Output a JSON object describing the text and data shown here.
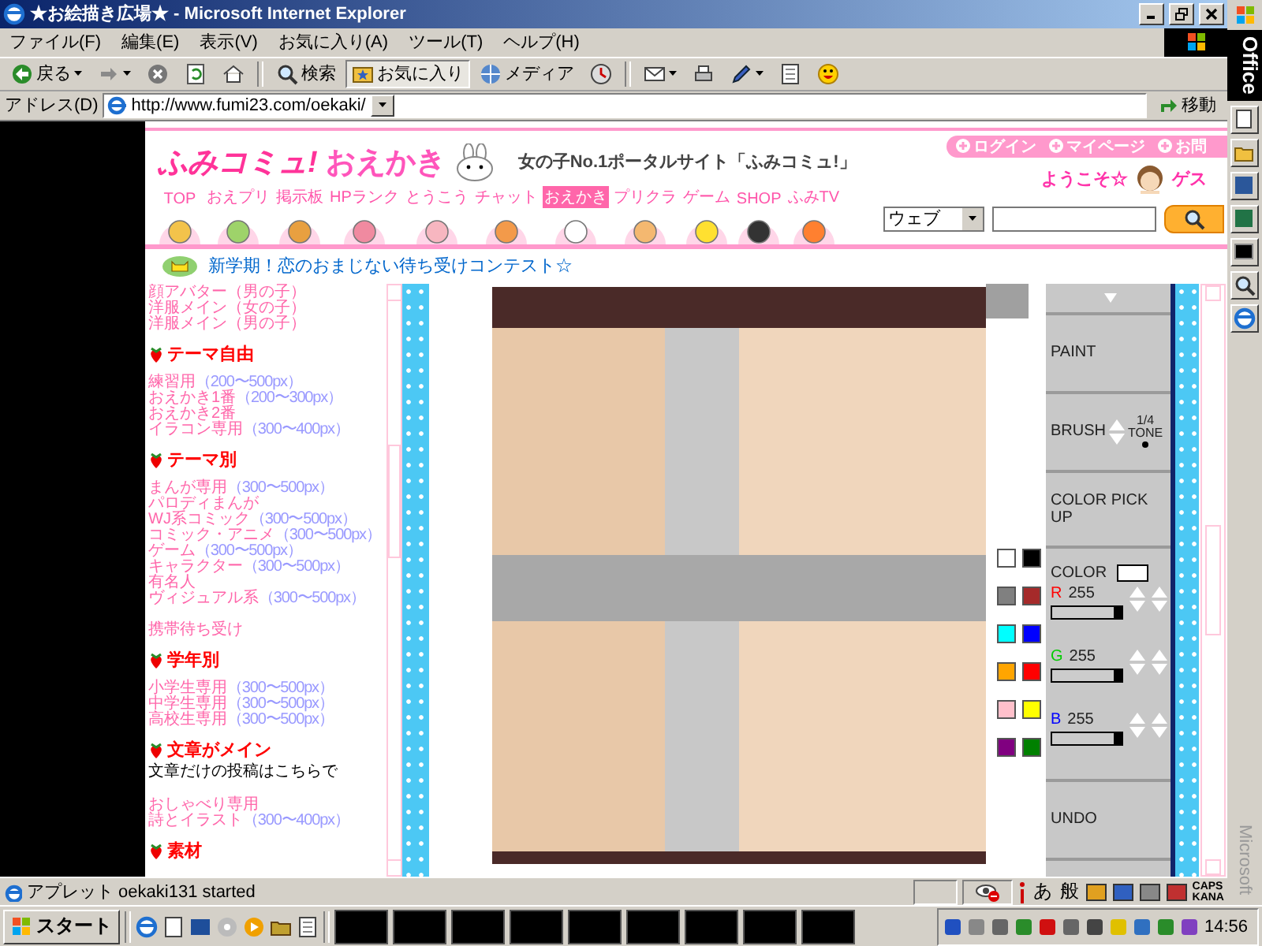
{
  "window": {
    "title": "★お絵描き広場★ - Microsoft Internet Explorer"
  },
  "menu": [
    "ファイル(F)",
    "編集(E)",
    "表示(V)",
    "お気に入り(A)",
    "ツール(T)",
    "ヘルプ(H)"
  ],
  "toolbar": [
    {
      "kind": "back",
      "label": "戻る",
      "pressed": false
    },
    {
      "kind": "forward",
      "pressed": false
    },
    {
      "kind": "stop",
      "pressed": false
    },
    {
      "kind": "refresh",
      "pressed": false
    },
    {
      "kind": "home",
      "pressed": false
    },
    {
      "kind": "search",
      "label": "検索",
      "pressed": false
    },
    {
      "kind": "favorites",
      "label": "お気に入り",
      "pressed": true
    },
    {
      "kind": "media",
      "label": "メディア",
      "pressed": false
    },
    {
      "kind": "history",
      "pressed": false
    },
    {
      "kind": "mail",
      "pressed": false
    },
    {
      "kind": "print",
      "pressed": false
    },
    {
      "kind": "edit",
      "pressed": false
    },
    {
      "kind": "discuss",
      "pressed": false
    },
    {
      "kind": "messenger",
      "pressed": false
    }
  ],
  "address_bar": {
    "label": "アドレス(D)",
    "url": "http://www.fumi23.com/oekaki/",
    "go": "移動"
  },
  "site_header": {
    "logo": "ふみコミュ!",
    "section": "おえかき",
    "tagline": "女の子No.1ポータルサイト「ふみコミュ!」",
    "account_links": [
      "ログイン",
      "マイページ",
      "お問"
    ],
    "welcome": "ようこそ☆",
    "user": "ゲス",
    "nav": [
      {
        "label": "TOP",
        "selected": false
      },
      {
        "label": "おえプリ",
        "selected": false
      },
      {
        "label": "掲示板",
        "selected": false
      },
      {
        "label": "HPランク",
        "selected": false
      },
      {
        "label": "とうこう",
        "selected": false
      },
      {
        "label": "チャット",
        "selected": false
      },
      {
        "label": "おえかき",
        "selected": true
      },
      {
        "label": "プリクラ",
        "selected": false
      },
      {
        "label": "ゲーム",
        "selected": false
      },
      {
        "label": "SHOP",
        "selected": false
      },
      {
        "label": "ふみTV",
        "selected": false
      }
    ],
    "search": {
      "scope": "ウェブ"
    }
  },
  "banner": "新学期！恋のおまじない待ち受けコンテスト☆",
  "sidebar": {
    "sections": [
      {
        "items": [
          {
            "name": "顔アバター（男の子）"
          },
          {
            "name": "洋服メイン（女の子）"
          },
          {
            "name": "洋服メイン（男の子）"
          }
        ]
      },
      {
        "heading": "テーマ自由",
        "items": [
          {
            "name": "練習用",
            "size": "（200〜500px）"
          },
          {
            "name": "おえかき1番",
            "size": "（200〜300px）"
          },
          {
            "name": "おえかき2番"
          },
          {
            "name": "イラコン専用",
            "size": "（300〜400px）"
          }
        ]
      },
      {
        "heading": "テーマ別",
        "items": [
          {
            "name": "まんが専用",
            "size": "（300〜500px）"
          },
          {
            "name": "パロディまんが"
          },
          {
            "name": "WJ系コミック",
            "size": "（300〜500px）"
          },
          {
            "name": "コミック・アニメ",
            "size": "（300〜500px）"
          },
          {
            "name": "ゲーム",
            "size": "（300〜500px）"
          },
          {
            "name": "キャラクター",
            "size": "（300〜500px）"
          },
          {
            "name": "有名人"
          },
          {
            "name": "ヴィジュアル系",
            "size": "（300〜500px）"
          }
        ]
      },
      {
        "items": [
          {
            "name": "携帯待ち受け"
          }
        ]
      },
      {
        "heading": "学年別",
        "items": [
          {
            "name": "小学生専用",
            "size": "（300〜500px）"
          },
          {
            "name": "中学生専用",
            "size": "（300〜500px）"
          },
          {
            "name": "高校生専用",
            "size": "（300〜500px）"
          }
        ]
      },
      {
        "heading": "文章がメイン",
        "note": "文章だけの投稿はこちらで"
      },
      {
        "items": [
          {
            "name": "おしゃべり専用"
          },
          {
            "name": "詩とイラスト",
            "size": "（300〜400px）"
          }
        ]
      },
      {
        "heading": "素材"
      }
    ]
  },
  "applet": {
    "palette": [
      {
        "color": "#ffffff"
      },
      {
        "color": "#000000"
      },
      {
        "color": "#808080"
      },
      {
        "color": "#a52a2a"
      },
      {
        "color": "#00ffff"
      },
      {
        "color": "#0000ff"
      },
      {
        "color": "#ffa500"
      },
      {
        "color": "#ff0000"
      },
      {
        "color": "#ffc0cb"
      },
      {
        "color": "#ffff00"
      },
      {
        "color": "#800080"
      },
      {
        "color": "#008000"
      }
    ],
    "tools": [
      {
        "kind": "button",
        "label": "PAINT"
      },
      {
        "kind": "brush",
        "label": "BRUSH",
        "size": "1/4",
        "mode": "TONE"
      },
      {
        "kind": "button",
        "label": "COLOR PICK UP"
      },
      {
        "kind": "color",
        "label": "COLOR",
        "channels": [
          {
            "name": "R",
            "color": "#ff0000",
            "value": "255",
            "level": 1
          },
          {
            "name": "G",
            "color": "#00cc00",
            "value": "255",
            "level": 1
          },
          {
            "name": "B",
            "color": "#0000ff",
            "value": "255",
            "level": 1
          }
        ]
      },
      {
        "kind": "button",
        "label": "UNDO"
      }
    ]
  },
  "status_bar": {
    "text": "アプレット oekaki131 started",
    "ime": [
      "あ",
      "般"
    ],
    "keys": [
      "CAPS",
      "KANA"
    ]
  },
  "taskbar": {
    "start": "スタート",
    "clock": "14:56"
  },
  "office_bar": {
    "title": "Office",
    "brand": "Microsoft"
  }
}
